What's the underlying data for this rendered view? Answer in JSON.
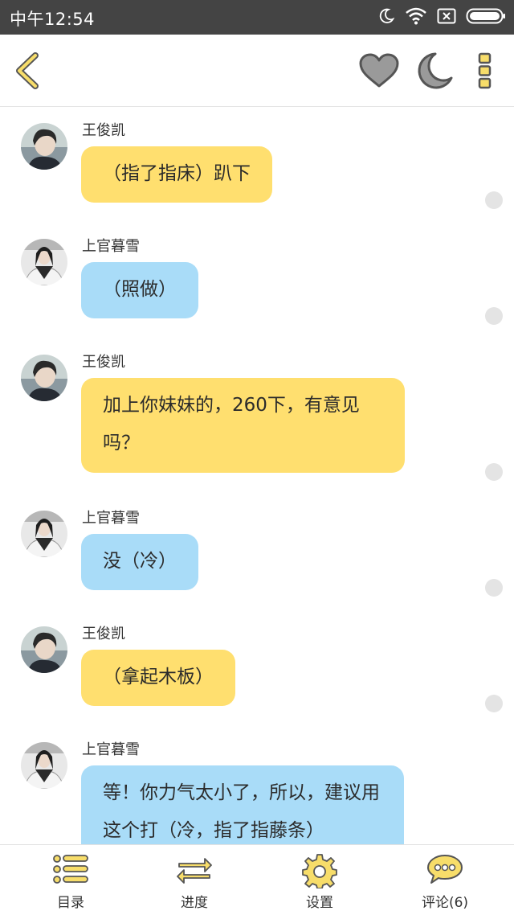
{
  "status_bar": {
    "time": "中午12:54",
    "icons": [
      "moon-icon",
      "wifi-icon",
      "no-sim-icon",
      "battery-icon"
    ]
  },
  "top_bar": {
    "icons": [
      "back-chevron-icon",
      "heart-icon",
      "moon-icon",
      "more-vertical-icon"
    ],
    "accent_color": "#f7dd6a"
  },
  "messages": [
    {
      "sender": "王俊凯",
      "text": "（指了指床）趴下",
      "color": "yellow"
    },
    {
      "sender": "上官暮雪",
      "text": "（照做）",
      "color": "blue"
    },
    {
      "sender": "王俊凯",
      "text_lines": [
        "加上你妹妹的，260下，有意见",
        "吗？"
      ],
      "color": "yellow"
    },
    {
      "sender": "上官暮雪",
      "text": "没（冷）",
      "color": "blue"
    },
    {
      "sender": "王俊凯",
      "text": "（拿起木板）",
      "color": "yellow"
    },
    {
      "sender": "上官暮雪",
      "text_lines": [
        "等！你力气太小了，所以，建议用",
        "这个打（冷，指了指藤条）"
      ],
      "color": "blue"
    }
  ],
  "colors": {
    "yellow_bubble": "#ffdf6f",
    "blue_bubble": "#a9dcf8",
    "status_bar": "#444444"
  },
  "bottom_nav": {
    "catalog": "目录",
    "progress": "进度",
    "settings": "设置",
    "comments": "评论(6)"
  }
}
